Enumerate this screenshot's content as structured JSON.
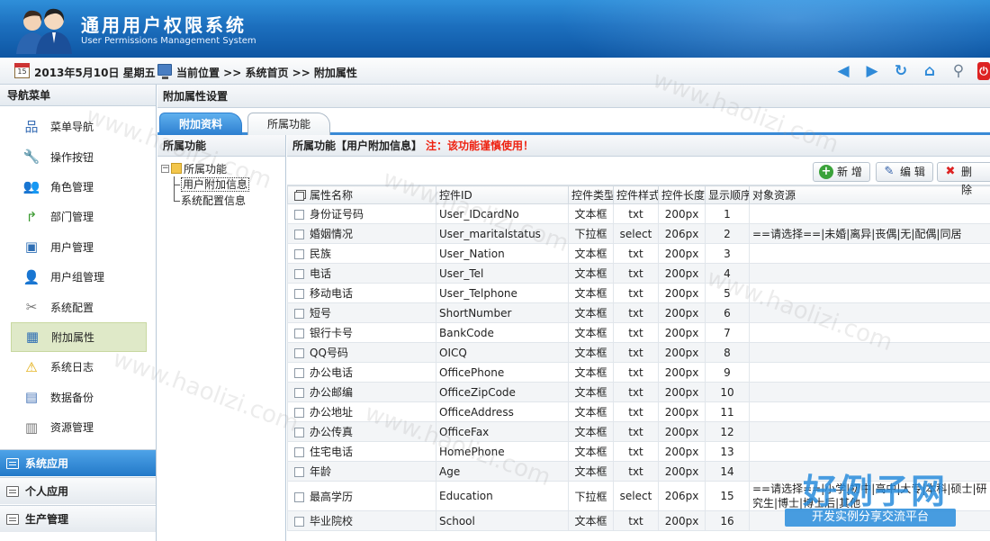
{
  "app": {
    "title_cn": "通用用户权限系统",
    "title_en": "User Permissions Management System"
  },
  "infobar": {
    "date": "2013年5月10日 星期五",
    "location": "当前位置 >> 系统首页 >> 附加属性",
    "calendar_day": "15",
    "tools": [
      "back-arrow-icon",
      "forward-arrow-icon",
      "refresh-icon",
      "home-icon",
      "search-icon",
      "exit-icon"
    ]
  },
  "sidebar": {
    "title": "导航菜单",
    "items": [
      {
        "label": "菜单导航",
        "icon": "sitemap-icon"
      },
      {
        "label": "操作按钮",
        "icon": "wrench-icon"
      },
      {
        "label": "角色管理",
        "icon": "users-icon"
      },
      {
        "label": "部门管理",
        "icon": "department-icon"
      },
      {
        "label": "用户管理",
        "icon": "user-card-icon"
      },
      {
        "label": "用户组管理",
        "icon": "user-group-icon"
      },
      {
        "label": "系统配置",
        "icon": "tools-icon"
      },
      {
        "label": "附加属性",
        "icon": "property-icon",
        "active": true
      },
      {
        "label": "系统日志",
        "icon": "warning-icon"
      },
      {
        "label": "数据备份",
        "icon": "backup-icon"
      },
      {
        "label": "资源管理",
        "icon": "resource-icon"
      }
    ],
    "sections": [
      {
        "label": "系统应用",
        "active": true
      },
      {
        "label": "个人应用"
      },
      {
        "label": "生产管理"
      }
    ]
  },
  "main": {
    "title": "附加属性设置",
    "tabs": [
      {
        "label": "附加资料",
        "active": true
      },
      {
        "label": "所属功能"
      }
    ]
  },
  "tree": {
    "title": "所属功能",
    "root": "所属功能",
    "children": [
      "用户附加信息",
      "系统配置信息"
    ]
  },
  "content": {
    "title": "所属功能【用户附加信息】",
    "warning": "注：该功能谨慎使用！",
    "buttons": {
      "add": "新 增",
      "edit": "编 辑",
      "delete": "删 除"
    },
    "columns": [
      "属性名称",
      "控件ID",
      "控件类型",
      "控件样式",
      "控件长度",
      "显示顺序",
      "对象资源"
    ],
    "rows": [
      [
        "身份证号码",
        "User_IDcardNo",
        "文本框",
        "txt",
        "200px",
        "1",
        ""
      ],
      [
        "婚姻情况",
        "User_maritalstatus",
        "下拉框",
        "select",
        "206px",
        "2",
        "==请选择==|未婚|离异|丧偶|无|配偶|同居"
      ],
      [
        "民族",
        "User_Nation",
        "文本框",
        "txt",
        "200px",
        "3",
        ""
      ],
      [
        "电话",
        "User_Tel",
        "文本框",
        "txt",
        "200px",
        "4",
        ""
      ],
      [
        "移动电话",
        "User_Telphone",
        "文本框",
        "txt",
        "200px",
        "5",
        ""
      ],
      [
        "短号",
        "ShortNumber",
        "文本框",
        "txt",
        "200px",
        "6",
        ""
      ],
      [
        "银行卡号",
        "BankCode",
        "文本框",
        "txt",
        "200px",
        "7",
        ""
      ],
      [
        "QQ号码",
        "OICQ",
        "文本框",
        "txt",
        "200px",
        "8",
        ""
      ],
      [
        "办公电话",
        "OfficePhone",
        "文本框",
        "txt",
        "200px",
        "9",
        ""
      ],
      [
        "办公邮编",
        "OfficeZipCode",
        "文本框",
        "txt",
        "200px",
        "10",
        ""
      ],
      [
        "办公地址",
        "OfficeAddress",
        "文本框",
        "txt",
        "200px",
        "11",
        ""
      ],
      [
        "办公传真",
        "OfficeFax",
        "文本框",
        "txt",
        "200px",
        "12",
        ""
      ],
      [
        "住宅电话",
        "HomePhone",
        "文本框",
        "txt",
        "200px",
        "13",
        ""
      ],
      [
        "年龄",
        "Age",
        "文本框",
        "txt",
        "200px",
        "14",
        ""
      ],
      [
        "最高学历",
        "Education",
        "下拉框",
        "select",
        "206px",
        "15",
        "==请选择==|小学|初中|高中|大专|本科|硕士|研究生|博士|博士后|其他"
      ],
      [
        "毕业院校",
        "School",
        "文本框",
        "txt",
        "200px",
        "16",
        ""
      ]
    ]
  },
  "watermark": "www.haolizi.com",
  "brand": {
    "name": "好例子网",
    "slogan": "开发实例分享交流平台"
  },
  "colors": {
    "header": "#1c6fbe",
    "tab_active": "#2d7fd0",
    "warning": "#e21111",
    "active_menu": "#dfe9c8"
  }
}
